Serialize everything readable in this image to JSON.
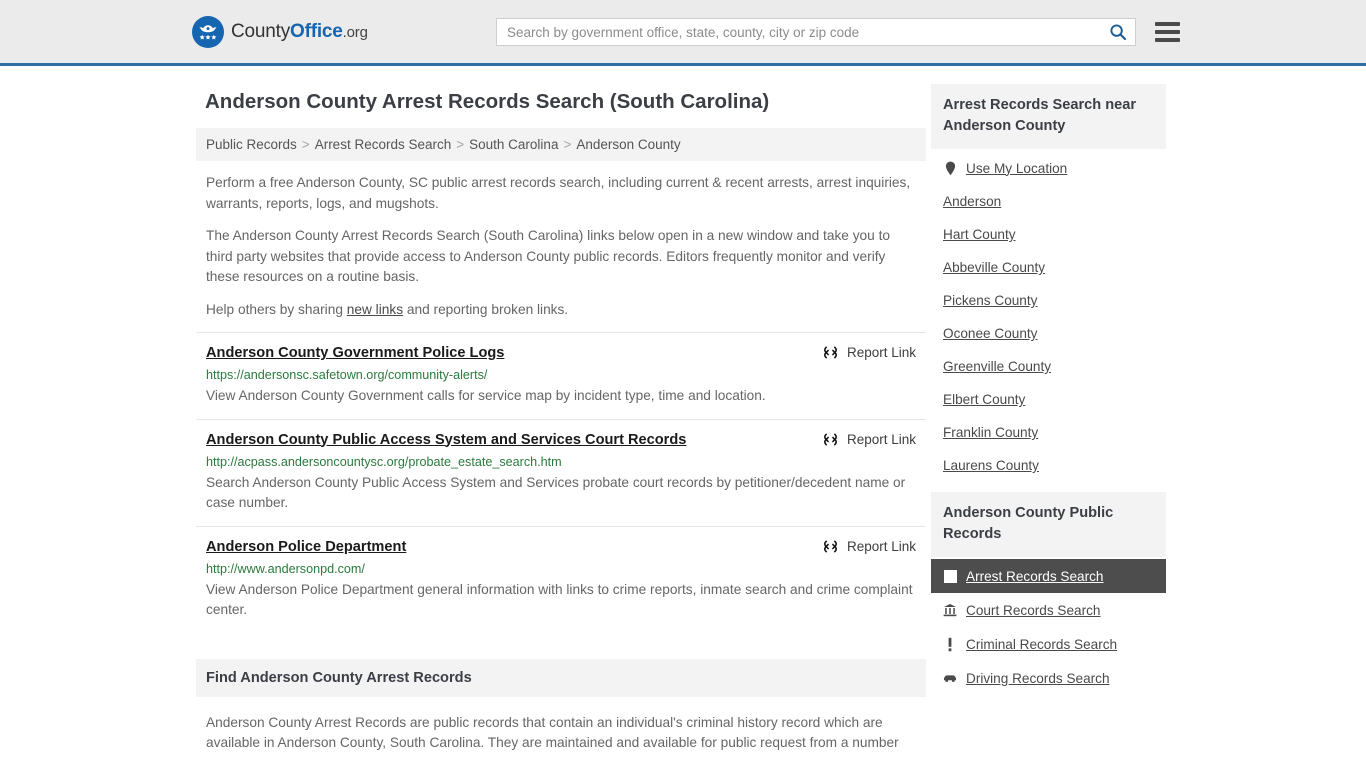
{
  "header": {
    "logo": {
      "icon": "eagle-seal-logo",
      "text_a": "County",
      "text_b": "Office",
      "text_c": ".org"
    },
    "search": {
      "placeholder": "Search by government office, state, county, city or zip code",
      "value": "",
      "search_icon": "search-icon"
    },
    "menu_icon": "hamburger-menu-icon"
  },
  "page": {
    "title": "Anderson County Arrest Records Search (South Carolina)"
  },
  "breadcrumb": {
    "separator": ">",
    "items": [
      {
        "label": "Public Records"
      },
      {
        "label": "Arrest Records Search"
      },
      {
        "label": "South Carolina"
      },
      {
        "label": "Anderson County"
      }
    ]
  },
  "intro": {
    "p1": "Perform a free Anderson County, SC public arrest records search, including current & recent arrests, arrest inquiries, warrants, reports, logs, and mugshots.",
    "p2": "The Anderson County Arrest Records Search (South Carolina) links below open in a new window and take you to third party websites that provide access to Anderson County public records. Editors frequently monitor and verify these resources on a routine basis.",
    "p3_before": "Help others by sharing ",
    "p3_link": "new links",
    "p3_after": " and reporting broken links."
  },
  "results": {
    "report_label": "Report Link",
    "report_icon": "broken-link-icon",
    "items": [
      {
        "title": "Anderson County Government Police Logs",
        "url": "https://andersonsc.safetown.org/community-alerts/",
        "description": "View Anderson County Government calls for service map by incident type, time and location."
      },
      {
        "title": "Anderson County Public Access System and Services Court Records",
        "url": "http://acpass.andersoncountysc.org/probate_estate_search.htm",
        "description": "Search Anderson County Public Access System and Services probate court records by petitioner/decedent name or case number."
      },
      {
        "title": "Anderson Police Department",
        "url": "http://www.andersonpd.com/",
        "description": "View Anderson Police Department general information with links to crime reports, inmate search and crime complaint center."
      }
    ]
  },
  "find_section": {
    "heading": "Find Anderson County Arrest Records",
    "paragraph": "Anderson County Arrest Records are public records that contain an individual's criminal history record which are available in Anderson County, South Carolina. They are maintained and available for public request from a number"
  },
  "sidebar": {
    "near_panel": {
      "heading": "Arrest Records Search near Anderson County",
      "items": [
        {
          "label": "Use My Location",
          "icon": "location-pin-icon",
          "active": false
        },
        {
          "label": "Anderson",
          "icon": "",
          "active": false
        },
        {
          "label": "Hart County",
          "icon": "",
          "active": false
        },
        {
          "label": "Abbeville County",
          "icon": "",
          "active": false
        },
        {
          "label": "Pickens County",
          "icon": "",
          "active": false
        },
        {
          "label": "Oconee County",
          "icon": "",
          "active": false
        },
        {
          "label": "Greenville County",
          "icon": "",
          "active": false
        },
        {
          "label": "Elbert County",
          "icon": "",
          "active": false
        },
        {
          "label": "Franklin County",
          "icon": "",
          "active": false
        },
        {
          "label": "Laurens County",
          "icon": "",
          "active": false
        }
      ]
    },
    "records_panel": {
      "heading": "Anderson County Public Records",
      "items": [
        {
          "label": "Arrest Records Search",
          "icon": "white-square-icon",
          "active": true
        },
        {
          "label": "Court Records Search",
          "icon": "courthouse-icon",
          "active": false
        },
        {
          "label": "Criminal Records Search",
          "icon": "exclamation-icon",
          "active": false
        },
        {
          "label": "Driving Records Search",
          "icon": "car-icon",
          "active": false
        }
      ]
    }
  },
  "colors": {
    "header_bg": "#ebebeb",
    "header_border": "#2e6ca4",
    "brand_blue": "#1565b0",
    "url_green": "#2b7a3d",
    "panel_bg": "#f3f3f3",
    "active_bg": "#4d4d4d"
  }
}
